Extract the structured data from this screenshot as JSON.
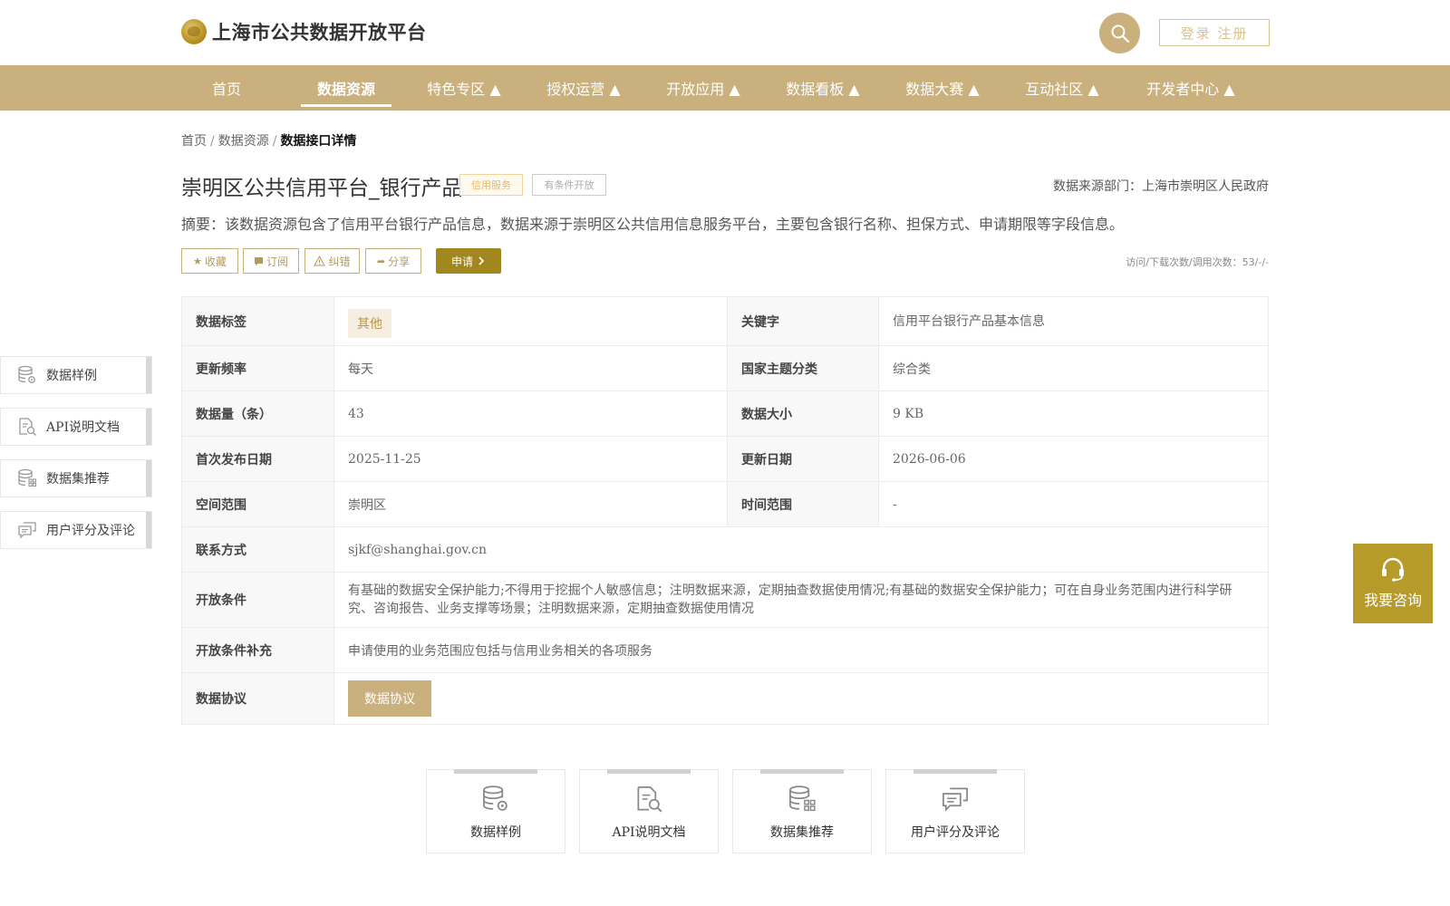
{
  "header": {
    "site_title": "上海市公共数据开放平台",
    "login_label": "登录 注册"
  },
  "nav": {
    "items": [
      {
        "label": "首页"
      },
      {
        "label": "数据资源"
      },
      {
        "label": "特色专区 ▲"
      },
      {
        "label": "授权运营 ▲"
      },
      {
        "label": "开放应用 ▲"
      },
      {
        "label": "数据看板 ▲"
      },
      {
        "label": "数据大赛 ▲"
      },
      {
        "label": "互动社区 ▲"
      },
      {
        "label": "开发者中心 ▲"
      }
    ],
    "active_index": 1
  },
  "breadcrumb": {
    "home": "首页",
    "resources": "数据资源",
    "current": "数据接口详情",
    "separator": "/"
  },
  "detail": {
    "title": "崇明区公共信用平台_银行产品",
    "tag_credit": "信用服务",
    "tag_open": "有条件开放",
    "source_dept": "数据来源部门：上海市崇明区人民政府",
    "summary": "摘要：该数据资源包含了信用平台银行产品信息，数据来源于崇明区公共信用信息服务平台，主要包含银行名称、担保方式、申请期限等字段信息。",
    "stats": "访问/下载次数/调用次数：53/-/-"
  },
  "actions": {
    "favorite": "收藏",
    "subscribe": "订阅",
    "correct": "纠错",
    "share": "分享",
    "apply": "申请"
  },
  "table": {
    "data_tag_key": "数据标签",
    "data_tag_value": "其他",
    "keyword_key": "关键字",
    "keyword_value": "信用平台银行产品基本信息",
    "freq_key": "更新频率",
    "freq_value": "每天",
    "theme_key": "国家主题分类",
    "theme_value": "综合类",
    "count_key": "数据量（条）",
    "count_value": "43",
    "size_key": "数据大小",
    "size_value": "9 KB",
    "first_pub_key": "首次发布日期",
    "first_pub_value": "2025-11-25",
    "update_key": "更新日期",
    "update_value": "2026-06-06",
    "space_key": "空间范围",
    "space_value": "崇明区",
    "time_key": "时间范围",
    "time_value": "-",
    "contact_key": "联系方式",
    "contact_value": "sjkf@shanghai.gov.cn",
    "cond_key": "开放条件",
    "cond_value": "有基础的数据安全保护能力;不得用于挖掘个人敏感信息；注明数据来源，定期抽查数据使用情况;有基础的数据安全保护能力；可在自身业务范围内进行科学研究、咨询报告、业务支撑等场景；注明数据来源，定期抽查数据使用情况",
    "cond_sup_key": "开放条件补充",
    "cond_sup_value": "申请使用的业务范围应包括与信用业务相关的各项服务",
    "agreement_key": "数据协议",
    "agreement_btn": "数据协议"
  },
  "side_nav": [
    {
      "label": "数据样例",
      "icon": "database-gear-icon"
    },
    {
      "label": "API说明文档",
      "icon": "document-search-icon"
    },
    {
      "label": "数据集推荐",
      "icon": "database-grid-icon"
    },
    {
      "label": "用户评分及评论",
      "icon": "comments-icon"
    }
  ],
  "bottom_cards": [
    {
      "label": "数据样例",
      "icon": "database-gear-icon"
    },
    {
      "label": "API说明文档",
      "icon": "document-search-icon"
    },
    {
      "label": "数据集推荐",
      "icon": "database-grid-icon"
    },
    {
      "label": "用户评分及评论",
      "icon": "comments-icon"
    }
  ],
  "consult": {
    "label": "我要咨询",
    "icon": "headset-icon"
  },
  "colors": {
    "brand_gold": "#c9b07c",
    "apply_olive": "#a2871e",
    "consult_gold": "#b69a2a"
  }
}
